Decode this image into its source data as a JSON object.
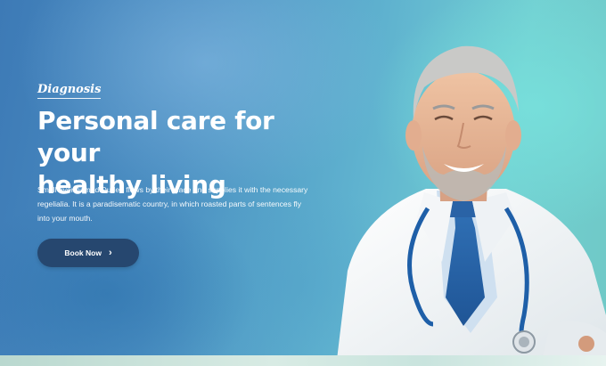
{
  "hero": {
    "eyebrow": "Diagnosis",
    "headline_line1": "Personal care for your",
    "headline_line2": "healthy living",
    "description": "Small river named Duden flows by their place and supplies it with the necessary regelialia. It is a paradisematic country, in which roasted parts of sentences fly into your mouth.",
    "cta_label": "Book Now",
    "cta_icon": "chevron-right-icon"
  },
  "colors": {
    "button_bg": "#26476f",
    "text": "#ffffff",
    "bg_left": "#3d7ab6",
    "bg_right": "#72d0d2"
  },
  "image": {
    "subject": "smiling doctor in white coat with stethoscope and blue tie"
  }
}
